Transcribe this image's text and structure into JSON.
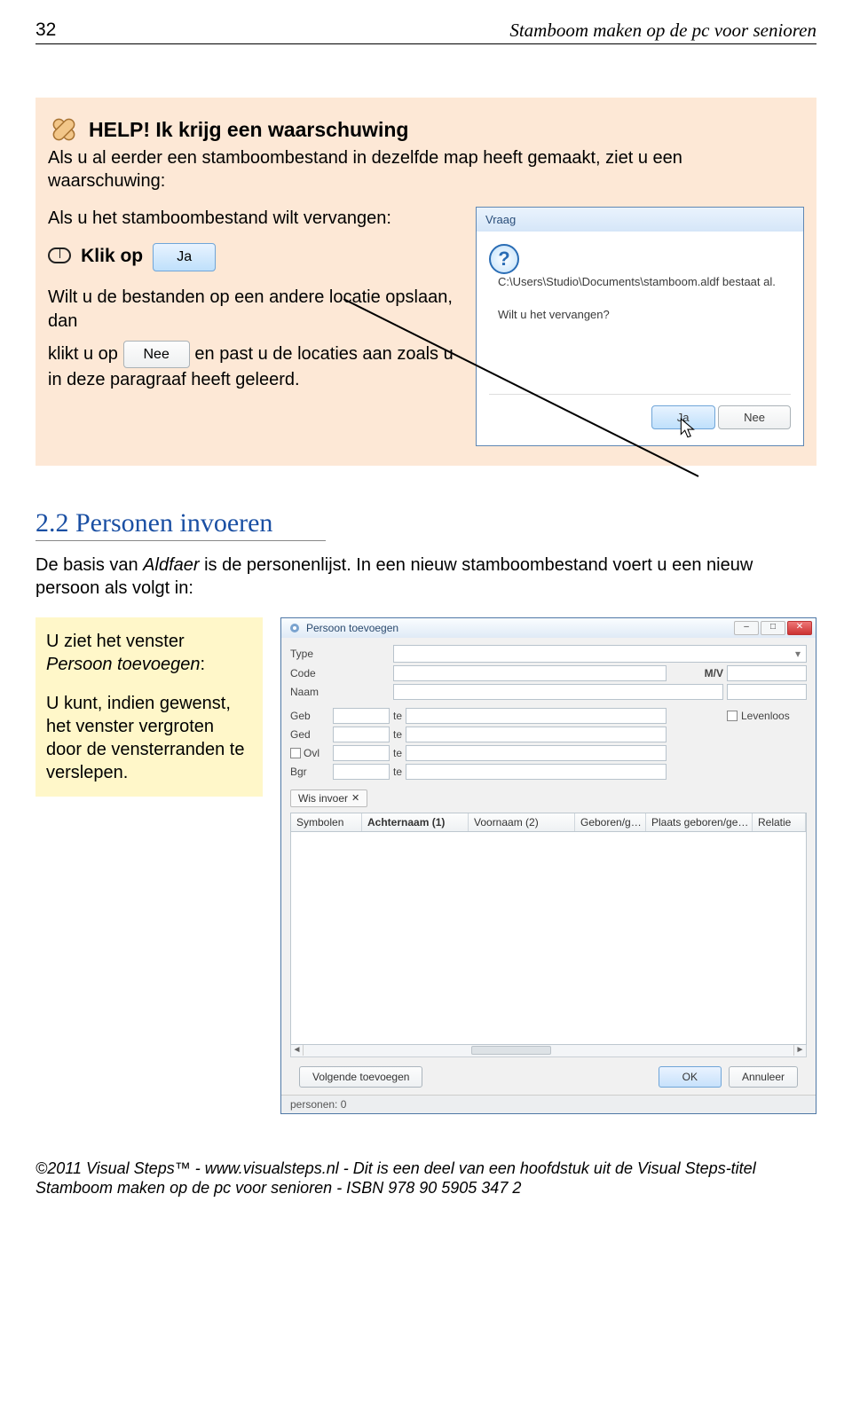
{
  "page": {
    "number": "32",
    "title": "Stamboom maken op de pc voor senioren"
  },
  "help": {
    "title": "HELP! Ik krijg een waarschuwing",
    "intro": "Als u al eerder een stamboombestand in dezelfde map heeft gemaakt, ziet u een waarschuwing:",
    "replace": "Als u het stamboombestand wilt vervangen:",
    "klik": "Klik op",
    "ja": "Ja",
    "other_loc": "Wilt u de bestanden op een andere locatie opslaan, dan",
    "klikt": "klikt u op",
    "nee": "Nee",
    "en_rest": "en past u de locaties aan zoals u in deze paragraaf heeft geleerd."
  },
  "dialog": {
    "title": "Vraag",
    "path": "C:\\Users\\Studio\\Documents\\stamboom.aldf bestaat al.",
    "question": "Wilt u het vervangen?",
    "ja": "Ja",
    "nee": "Nee"
  },
  "section2": {
    "heading": "2.2 Personen invoeren",
    "para": "De basis van Aldfaer is de personenlijst. In een nieuw stamboombestand voert u een nieuw persoon als volgt in:",
    "left1a": "U ziet het venster",
    "left1b": "Persoon toevoegen",
    "left2": "U kunt, indien gewenst, het venster vergroten door de vensterranden te verslepen."
  },
  "window": {
    "title": "Persoon toevoegen",
    "labels": {
      "type": "Type",
      "code": "Code",
      "naam": "Naam",
      "geb": "Geb",
      "ged": "Ged",
      "ovl": "Ovl",
      "bgr": "Bgr",
      "te": "te",
      "mv": "M/V",
      "levenloos": "Levenloos"
    },
    "wis": "Wis invoer",
    "wis_x": "✕",
    "cols": {
      "c1": "Symbolen",
      "c2": "Achternaam (1)",
      "c3": "Voornaam (2)",
      "c4": "Geboren/g…",
      "c5": "Plaats geboren/ge…",
      "c6": "Relatie"
    },
    "btns": {
      "volg": "Volgende toevoegen",
      "ok": "OK",
      "ann": "Annuleer"
    },
    "status": "personen: 0"
  },
  "footer": {
    "line1": "©2011 Visual Steps™ - www.visualsteps.nl - Dit is een deel van een hoofdstuk uit de Visual Steps-titel",
    "line2": "Stamboom maken op de pc voor senioren - ISBN 978 90 5905 347 2"
  }
}
